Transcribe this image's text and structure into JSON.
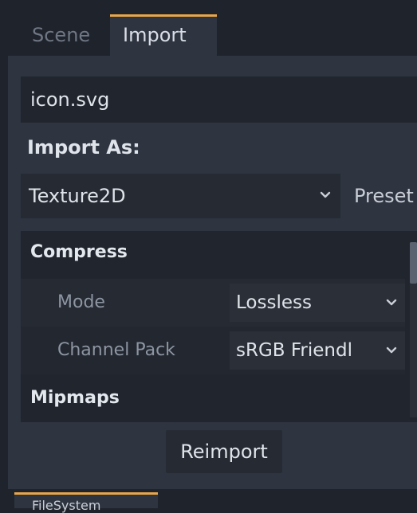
{
  "tabs": [
    {
      "label": "Scene",
      "active": false
    },
    {
      "label": "Import",
      "active": true
    }
  ],
  "file": {
    "name": "icon.svg"
  },
  "import_as": {
    "label": "Import As:",
    "selected": "Texture2D",
    "preset_label": "Preset"
  },
  "inspector": {
    "sections": [
      {
        "title": "Compress",
        "expanded": true
      },
      {
        "title": "Mipmaps",
        "expanded": true
      }
    ],
    "properties": [
      {
        "label": "Mode",
        "value": "Lossless"
      },
      {
        "label": "Channel Pack",
        "value": "sRGB Friendl"
      }
    ]
  },
  "reimport": {
    "label": "Reimport"
  },
  "bottom_tab": {
    "label": "FileSystem"
  },
  "colors": {
    "accent": "#e8a64a",
    "background": "#1f232b",
    "panel": "#2e3440"
  },
  "icons": {
    "dropdown": "chevron-down-icon"
  }
}
